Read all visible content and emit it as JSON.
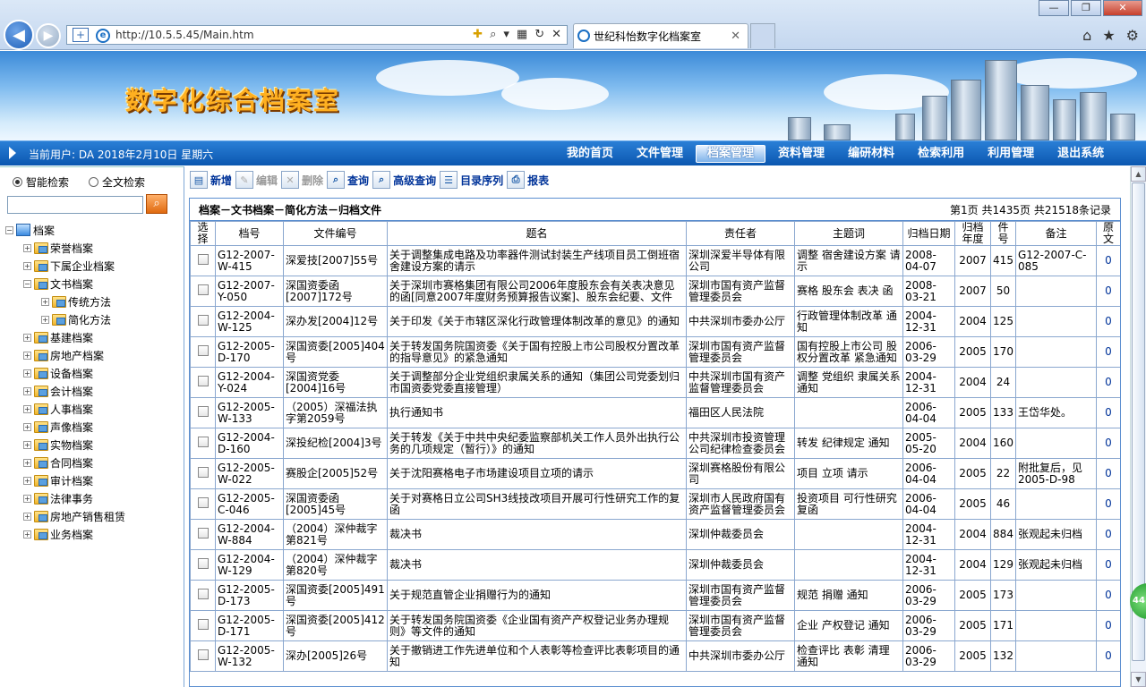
{
  "browser": {
    "url": "http://10.5.5.45/Main.htm",
    "tab_title": "世纪科怡数字化档案室",
    "win_min": "—",
    "win_max": "❐",
    "win_close": "✕"
  },
  "banner": {
    "title": "数字化综合档案室"
  },
  "header": {
    "user_info": "当前用户: DA   2018年2月10日  星期六",
    "nav": [
      "我的首页",
      "文件管理",
      "档案管理",
      "资料管理",
      "编研材料",
      "检索利用",
      "利用管理",
      "退出系统"
    ],
    "active_nav": "档案管理"
  },
  "sidebar": {
    "radio_smart": "智能检索",
    "radio_full": "全文检索",
    "search_placeholder": "",
    "tree_root": "档案",
    "tree": [
      {
        "label": "荣誉档案",
        "level": 1,
        "expand": "+"
      },
      {
        "label": "下属企业档案",
        "level": 1,
        "expand": "+"
      },
      {
        "label": "文书档案",
        "level": 1,
        "expand": "−"
      },
      {
        "label": "传统方法",
        "level": 2,
        "expand": "+"
      },
      {
        "label": "简化方法",
        "level": 2,
        "expand": "+"
      },
      {
        "label": "基建档案",
        "level": 1,
        "expand": "+"
      },
      {
        "label": "房地产档案",
        "level": 1,
        "expand": "+"
      },
      {
        "label": "设备档案",
        "level": 1,
        "expand": "+"
      },
      {
        "label": "会计档案",
        "level": 1,
        "expand": "+"
      },
      {
        "label": "人事档案",
        "level": 1,
        "expand": "+"
      },
      {
        "label": "声像档案",
        "level": 1,
        "expand": "+"
      },
      {
        "label": "实物档案",
        "level": 1,
        "expand": "+"
      },
      {
        "label": "合同档案",
        "level": 1,
        "expand": "+"
      },
      {
        "label": "审计档案",
        "level": 1,
        "expand": "+"
      },
      {
        "label": "法律事务",
        "level": 1,
        "expand": "+"
      },
      {
        "label": "房地产销售租赁",
        "level": 1,
        "expand": "+"
      },
      {
        "label": "业务档案",
        "level": 1,
        "expand": "+"
      }
    ]
  },
  "toolbar": {
    "new": "新增",
    "edit": "编辑",
    "delete": "删除",
    "query": "查询",
    "advanced": "高级查询",
    "catalog": "目录序列",
    "report": "报表"
  },
  "panel": {
    "breadcrumb": "档案－文书档案－简化方法－归档文件",
    "pagination": "第1页  共1435页  共21518条记录"
  },
  "table": {
    "headers": [
      "选择",
      "档号",
      "文件编号",
      "题名",
      "责任者",
      "主题词",
      "归档日期",
      "归档年度",
      "件号",
      "备注",
      "原文"
    ],
    "rows": [
      [
        "G12-2007-W-415",
        "深爱技[2007]55号",
        "关于调整集成电路及功率器件测试封装生产线项目员工倒班宿舍建设方案的请示",
        "深圳深爱半导体有限公司",
        "调整 宿舍建设方案 请示",
        "2008-04-07",
        "2007",
        "415",
        "G12-2007-C-085",
        "0"
      ],
      [
        "G12-2007-Y-050",
        "深国资委函[2007]172号",
        "关于深圳市赛格集团有限公司2006年度股东会有关表决意见的函[同意2007年度财务预算报告议案]、股东会纪要、文件",
        "深圳市国有资产监督管理委员会",
        "赛格 股东会 表决 函",
        "2008-03-21",
        "2007",
        "50",
        "",
        "0"
      ],
      [
        "G12-2004-W-125",
        "深办发[2004]12号",
        "关于印发《关于市辖区深化行政管理体制改革的意见》的通知",
        "中共深圳市委办公厅",
        "行政管理体制改革 通知",
        "2004-12-31",
        "2004",
        "125",
        "",
        "0"
      ],
      [
        "G12-2005-D-170",
        "深国资委[2005]404号",
        "关于转发国务院国资委《关于国有控股上市公司股权分置改革的指导意见》的紧急通知",
        "深圳市国有资产监督管理委员会",
        "国有控股上市公司 股权分置改革 紧急通知",
        "2006-03-29",
        "2005",
        "170",
        "",
        "0"
      ],
      [
        "G12-2004-Y-024",
        "深国资党委[2004]16号",
        "关于调整部分企业党组织隶属关系的通知（集团公司党委划归市国资委党委直接管理）",
        "中共深圳市国有资产监督管理委员会",
        "调整 党组织 隶属关系 通知",
        "2004-12-31",
        "2004",
        "24",
        "",
        "0"
      ],
      [
        "G12-2005-W-133",
        "（2005）深福法执字第2059号",
        "执行通知书",
        "福田区人民法院",
        "",
        "2006-04-04",
        "2005",
        "133",
        "王岱华处。",
        "0"
      ],
      [
        "G12-2004-D-160",
        "深投纪检[2004]3号",
        "关于转发《关于中共中央纪委监察部机关工作人员外出执行公务的几项规定（暂行）》的通知",
        "中共深圳市投资管理公司纪律检查委员会",
        "转发 纪律规定 通知",
        "2005-05-20",
        "2004",
        "160",
        "",
        "0"
      ],
      [
        "G12-2005-W-022",
        "赛股企[2005]52号",
        "关于沈阳赛格电子市场建设项目立项的请示",
        "深圳赛格股份有限公司",
        "项目 立项 请示",
        "2006-04-04",
        "2005",
        "22",
        "附批复后，见2005-D-98",
        "0"
      ],
      [
        "G12-2005-C-046",
        "深国资委函[2005]45号",
        "关于对赛格日立公司SH3线技改项目开展可行性研究工作的复函",
        "深圳市人民政府国有资产监督管理委员会",
        "投资项目 可行性研究 复函",
        "2006-04-04",
        "2005",
        "46",
        "",
        "0"
      ],
      [
        "G12-2004-W-884",
        "（2004）深仲裁字第821号",
        "裁决书",
        "深圳仲裁委员会",
        "",
        "2004-12-31",
        "2004",
        "884",
        "张观起未归档",
        "0"
      ],
      [
        "G12-2004-W-129",
        "（2004）深仲裁字第820号",
        "裁决书",
        "深圳仲裁委员会",
        "",
        "2004-12-31",
        "2004",
        "129",
        "张观起未归档",
        "0"
      ],
      [
        "G12-2005-D-173",
        "深国资委[2005]491号",
        "关于规范直管企业捐赠行为的通知",
        "深圳市国有资产监督管理委员会",
        "规范 捐赠 通知",
        "2006-03-29",
        "2005",
        "173",
        "",
        "0"
      ],
      [
        "G12-2005-D-171",
        "深国资委[2005]412号",
        "关于转发国务院国资委《企业国有资产产权登记业务办理规则》等文件的通知",
        "深圳市国有资产监督管理委员会",
        "企业 产权登记 通知",
        "2006-03-29",
        "2005",
        "171",
        "",
        "0"
      ],
      [
        "G12-2005-W-132",
        "深办[2005]26号",
        "关于撤销进工作先进单位和个人表彰等检查评比表彰项目的通知",
        "中共深圳市委办公厅",
        "检查评比 表彰 清理 通知",
        "2006-03-29",
        "2005",
        "132",
        "",
        "0"
      ]
    ]
  },
  "scrollbar": {
    "up": "▲",
    "down": "▼"
  },
  "badge": {
    "text": "44"
  }
}
